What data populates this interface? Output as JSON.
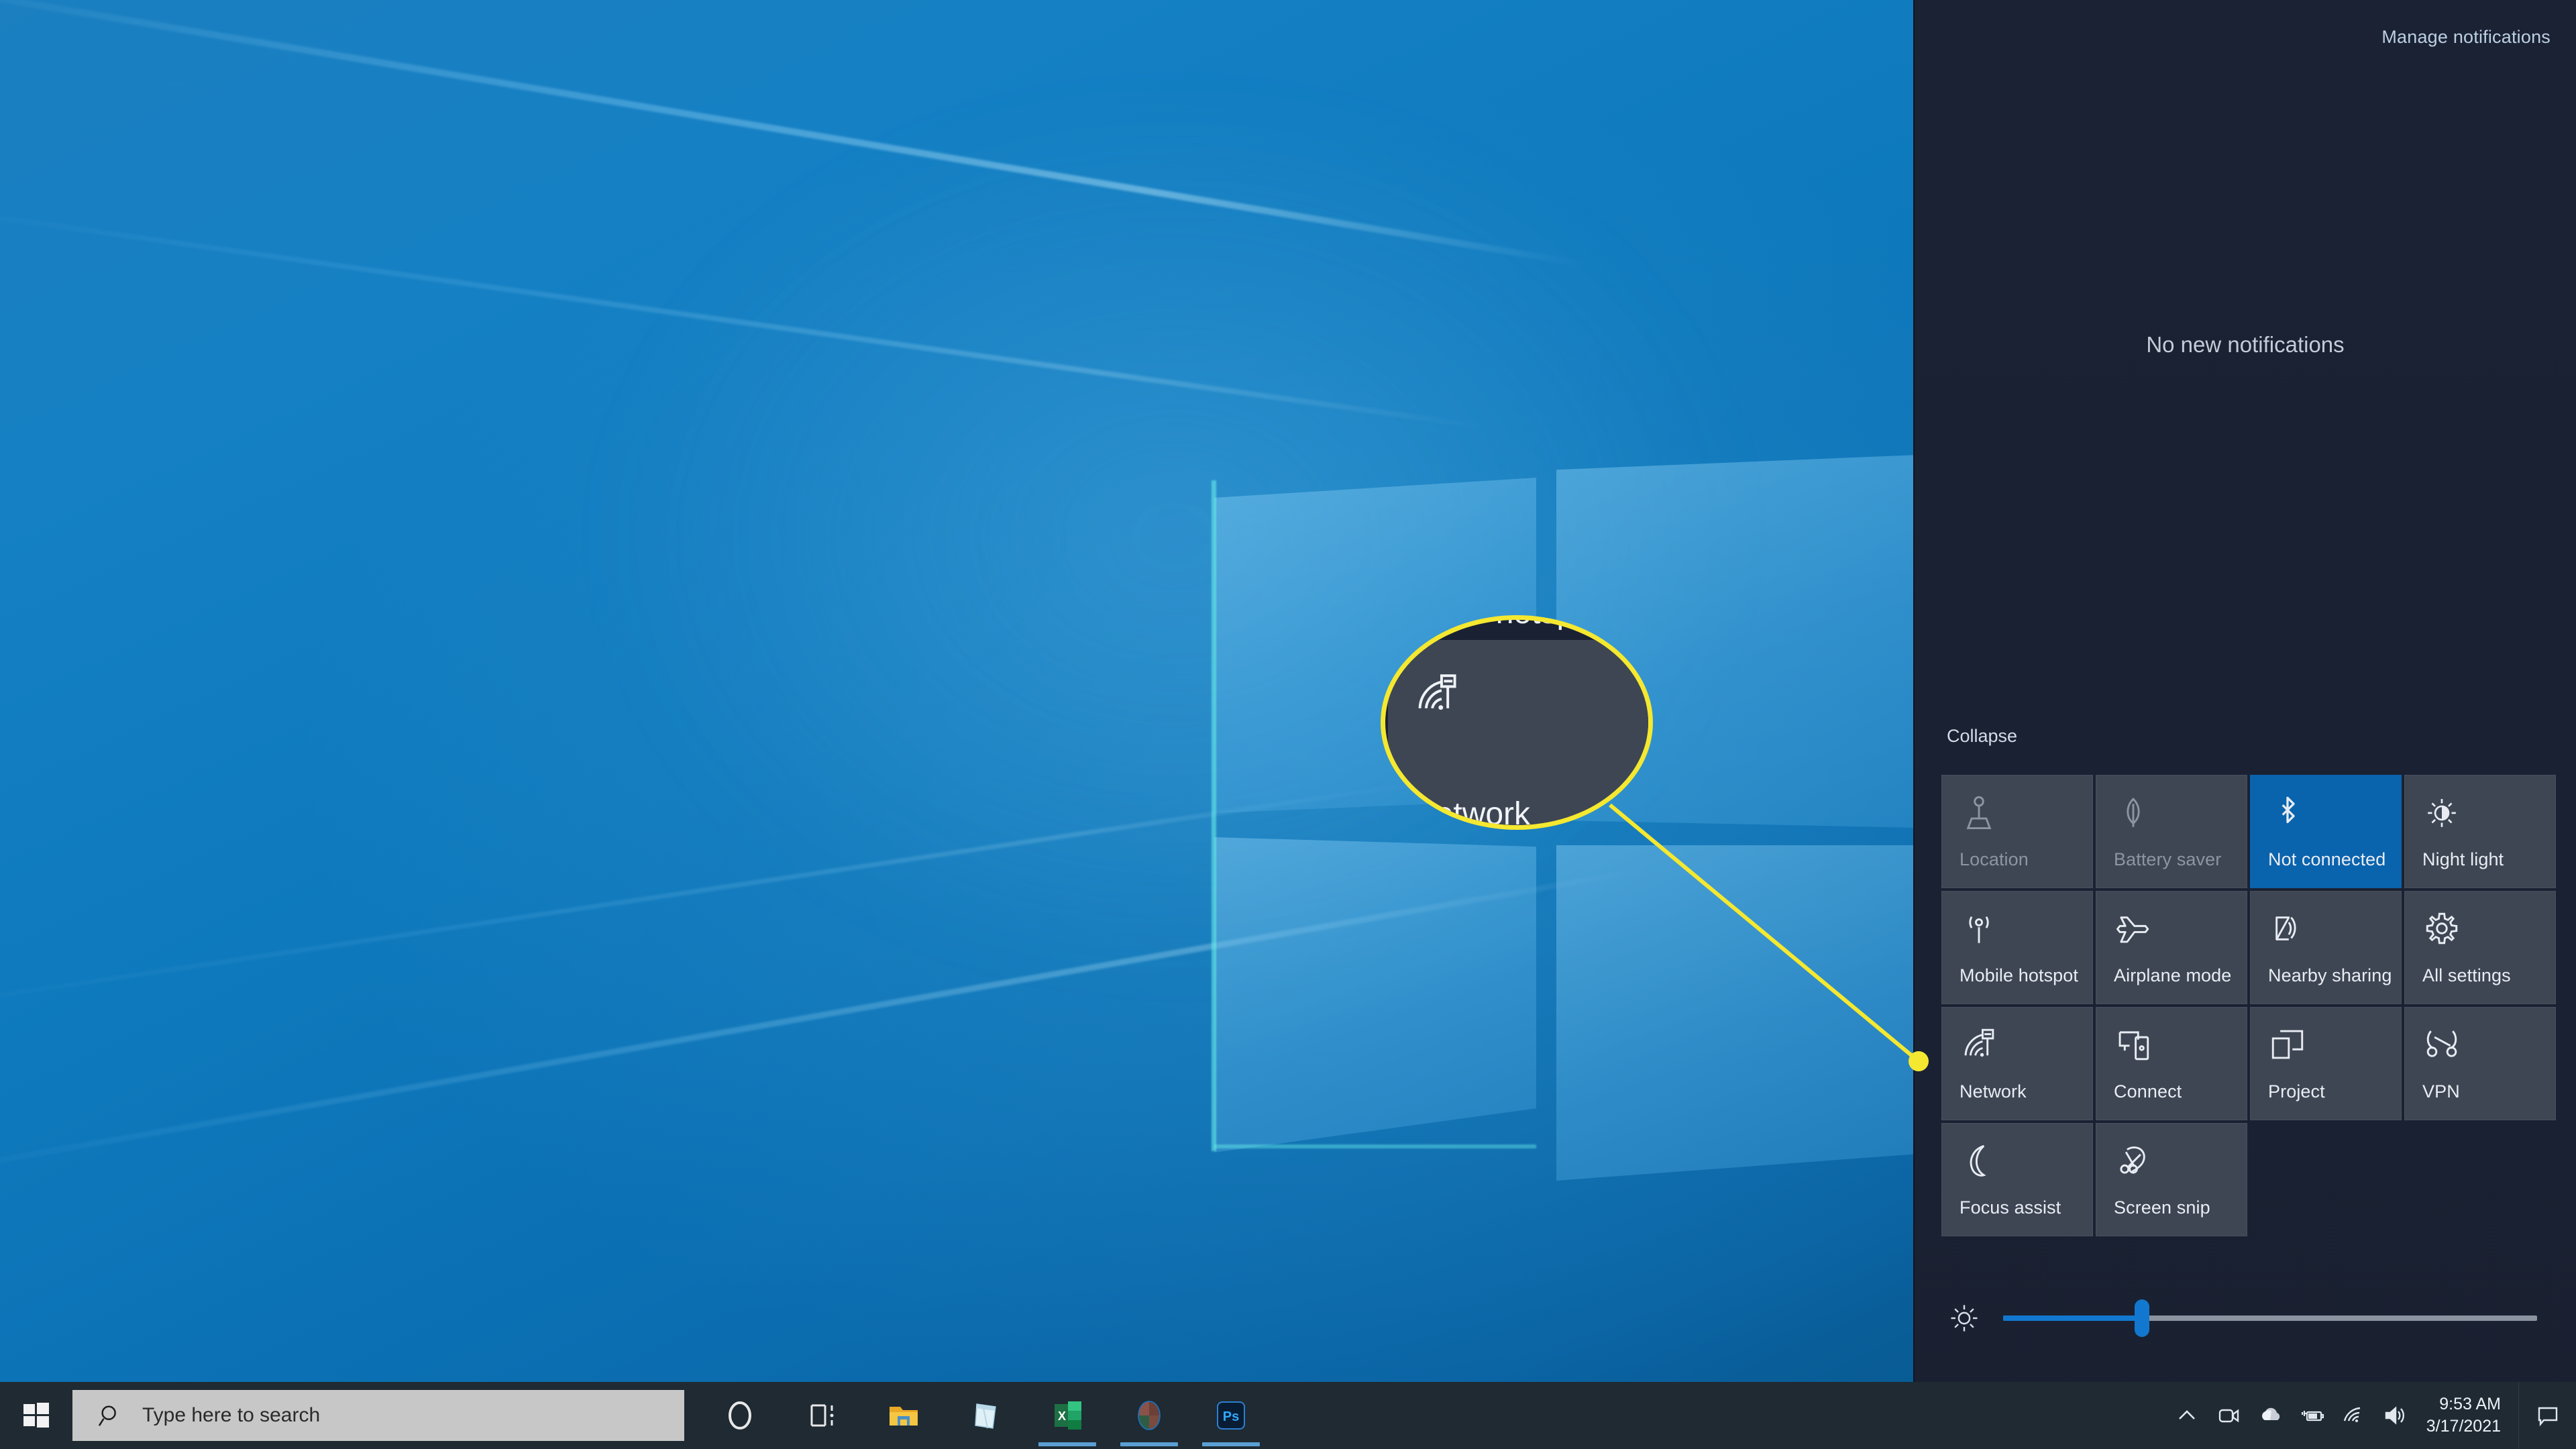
{
  "desktop": {
    "wallpaper_name": "windows-10-hero-wallpaper",
    "base_color": "#0e79bd"
  },
  "action_center": {
    "manage_notifications_label": "Manage notifications",
    "empty_state_label": "No new notifications",
    "collapse_label": "Collapse",
    "accent_color": "#0a63ad",
    "panel_color": "#1a2132",
    "tile_color": "#3e4654",
    "tiles": [
      {
        "label": "Location",
        "icon": "location-icon",
        "state": "off",
        "row": 1
      },
      {
        "label": "Battery saver",
        "icon": "battery-leaf-icon",
        "state": "off",
        "row": 1
      },
      {
        "label": "Not connected",
        "icon": "bluetooth-icon",
        "state": "on",
        "row": 1
      },
      {
        "label": "Night light",
        "icon": "night-light-icon",
        "state": "idle",
        "row": 1
      },
      {
        "label": "Mobile hotspot",
        "icon": "mobile-hotspot-icon",
        "state": "idle",
        "row": 2
      },
      {
        "label": "Airplane mode",
        "icon": "airplane-icon",
        "state": "idle",
        "row": 2
      },
      {
        "label": "Nearby sharing",
        "icon": "nearby-sharing-icon",
        "state": "idle",
        "row": 2
      },
      {
        "label": "All settings",
        "icon": "gear-icon",
        "state": "idle",
        "row": 2
      },
      {
        "label": "Network",
        "icon": "network-wifi-icon",
        "state": "idle",
        "row": 3
      },
      {
        "label": "Connect",
        "icon": "connect-icon",
        "state": "idle",
        "row": 3
      },
      {
        "label": "Project",
        "icon": "project-icon",
        "state": "idle",
        "row": 3
      },
      {
        "label": "VPN",
        "icon": "vpn-icon",
        "state": "idle",
        "row": 3
      },
      {
        "label": "Focus assist",
        "icon": "moon-icon",
        "state": "idle",
        "row": 4
      },
      {
        "label": "Screen snip",
        "icon": "screen-snip-icon",
        "state": "idle",
        "row": 4
      }
    ],
    "brightness": {
      "icon": "brightness-icon",
      "value_percent": 26
    }
  },
  "callout": {
    "target_tile_label": "Network",
    "partial_label_above": "Mobile hotsp",
    "highlight_color": "#f5e830"
  },
  "taskbar": {
    "start_label": "Start",
    "search_placeholder": "Type here to search",
    "search_value": "",
    "apps": [
      {
        "name": "cortana",
        "icon": "cortana-icon",
        "running": false
      },
      {
        "name": "task-view",
        "icon": "task-view-icon",
        "running": false
      },
      {
        "name": "file-explorer",
        "icon": "file-explorer-icon",
        "running": false
      },
      {
        "name": "sticky-notes",
        "icon": "sticky-notes-icon",
        "running": false
      },
      {
        "name": "excel",
        "icon": "excel-icon",
        "running": true
      },
      {
        "name": "browser",
        "icon": "browser-icon",
        "running": true
      },
      {
        "name": "photoshop",
        "icon": "photoshop-icon",
        "running": true
      }
    ],
    "tray": [
      {
        "name": "show-hidden-icons",
        "icon": "chevron-up-icon"
      },
      {
        "name": "camera",
        "icon": "camera-icon"
      },
      {
        "name": "onedrive",
        "icon": "cloud-icon"
      },
      {
        "name": "battery",
        "icon": "battery-charging-icon"
      },
      {
        "name": "wifi",
        "icon": "wifi-icon"
      },
      {
        "name": "volume",
        "icon": "speaker-icon"
      }
    ],
    "clock": {
      "time": "9:53 AM",
      "date": "3/17/2021"
    },
    "action_center_icon": "speech-bubble-icon"
  }
}
